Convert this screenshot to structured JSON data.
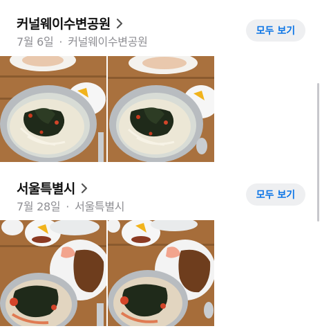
{
  "sections": [
    {
      "title": "커널웨이수변공원",
      "date": "7월 6일",
      "separator": "·",
      "place": "커널웨이수변공원",
      "see_all_label": "모두 보기",
      "photos": [
        "noodle-soup-photo",
        "noodle-soup-photo"
      ]
    },
    {
      "title": "서울특별시",
      "date": "7월 28일",
      "separator": "·",
      "place": "서울특별시",
      "see_all_label": "모두 보기",
      "photos": [
        "noodle-soup-cutlet-photo",
        "noodle-soup-cutlet-photo"
      ]
    }
  ],
  "icons": {
    "chevron": "chevron-right-icon"
  },
  "colors": {
    "accent": "#0a74e6",
    "pill_bg": "#eeeff1",
    "secondary_text": "#8e8e93"
  }
}
